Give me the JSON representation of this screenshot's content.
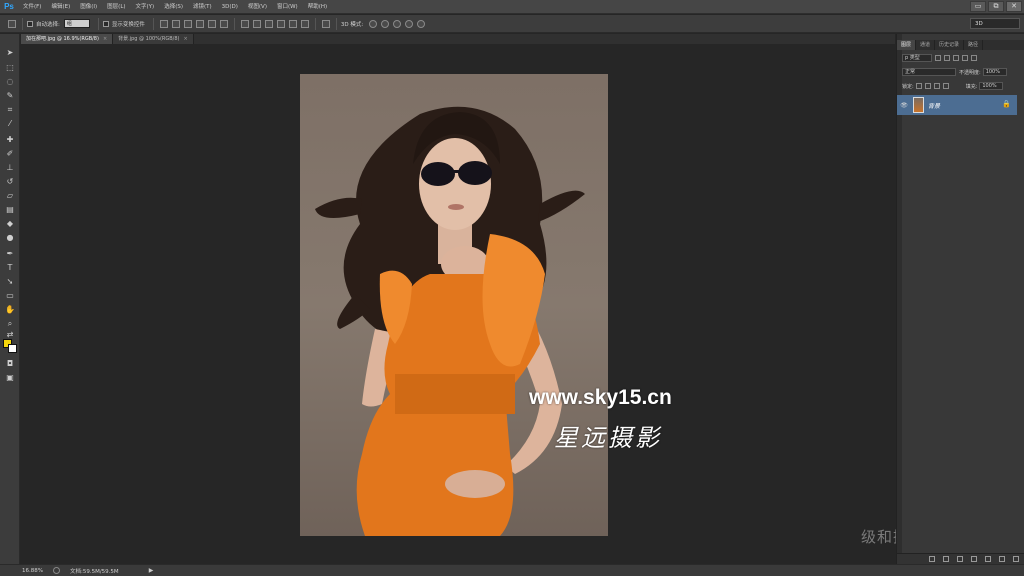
{
  "app": {
    "logo": "Ps"
  },
  "menu": [
    "文件(F)",
    "编辑(E)",
    "图像(I)",
    "图层(L)",
    "文字(Y)",
    "选择(S)",
    "滤镜(T)",
    "3D(D)",
    "视图(V)",
    "窗口(W)",
    "帮助(H)"
  ],
  "window_controls": {
    "minimize": "▭",
    "restore": "⧉",
    "close": "✕"
  },
  "options": {
    "auto_select_label": "自动选择:",
    "auto_select_value": "组",
    "transform_label": "显示变换控件",
    "mode_3d_label": "3D 模式:",
    "workspace": "3D"
  },
  "tabs": [
    {
      "label": "加在那吧.jpg @ 16.9%(RGB/8)",
      "close": "×",
      "active": true
    },
    {
      "label": "背景.jpg @ 100%(RGB/8)",
      "close": "×",
      "active": false
    }
  ],
  "watermark": {
    "url": "www.sky15.cn",
    "name_cn": "星远摄影",
    "tutorial": "级和摄影后期教程"
  },
  "status": {
    "zoom": "16.88%",
    "doc_info": "文档:59.5M/59.5M",
    "arrow": "▶"
  },
  "panel": {
    "tabs": [
      "图层",
      "通道",
      "历史记录",
      "路径"
    ],
    "filter_label": "p 类型",
    "blend_mode": "正常",
    "opacity_label": "不透明度:",
    "opacity_value": "100%",
    "lock_label": "锁定:",
    "fill_label": "填充:",
    "fill_value": "100%",
    "layer": {
      "name": "背景",
      "eye": "👁",
      "lock": "🔒"
    }
  },
  "colors": {
    "foreground": "#f5d60c",
    "background": "#ffffff",
    "layer_selected": "#4c6d92"
  }
}
